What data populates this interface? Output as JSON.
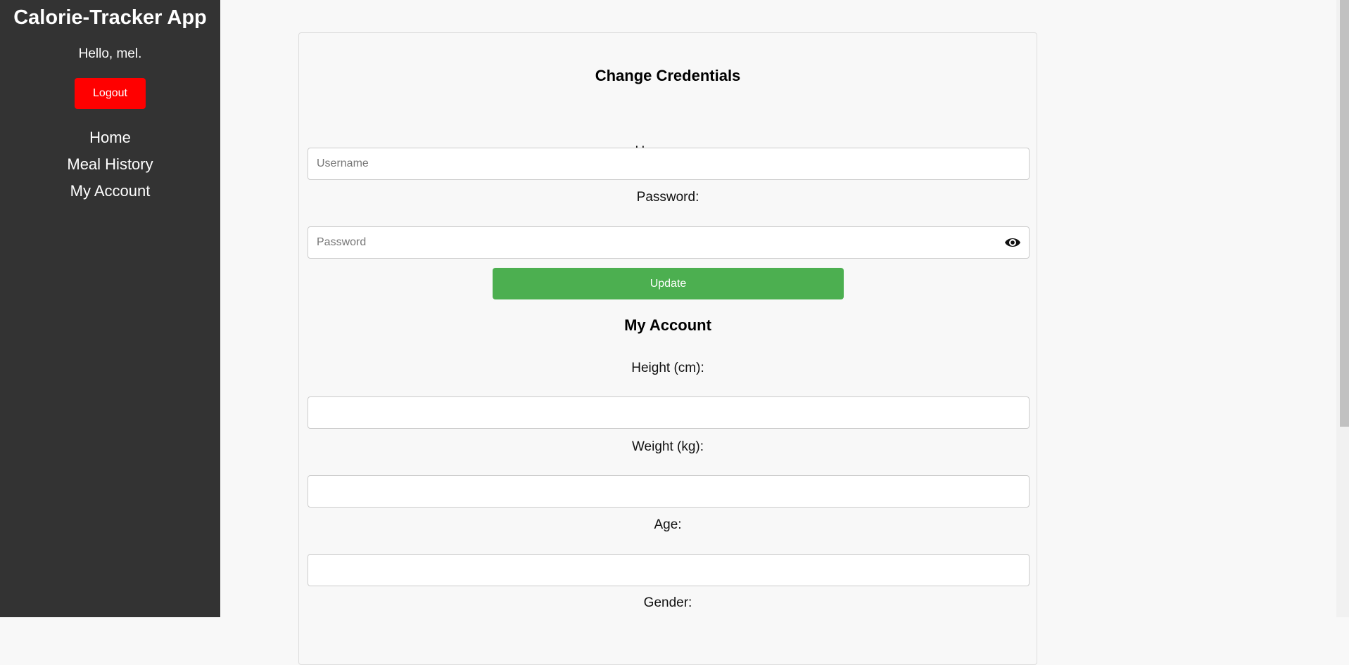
{
  "sidebar": {
    "title": "Calorie-Tracker App",
    "greeting": "Hello, mel.",
    "logout_label": "Logout",
    "nav": [
      {
        "label": "Home"
      },
      {
        "label": "Meal History"
      },
      {
        "label": "My Account"
      }
    ]
  },
  "credentials": {
    "title": "Change Credentials",
    "username_label": "Username:",
    "username_placeholder": "Username",
    "username_value": "",
    "password_label": "Password:",
    "password_placeholder": "Password",
    "password_value": "",
    "update_label": "Update"
  },
  "account": {
    "title": "My Account",
    "height_label": "Height (cm):",
    "height_value": "",
    "weight_label": "Weight (kg):",
    "weight_value": "",
    "age_label": "Age:",
    "age_value": "",
    "gender_label": "Gender:"
  },
  "colors": {
    "sidebar_bg": "#333333",
    "logout_bg": "#ff0000",
    "update_bg": "#4caf50",
    "page_bg": "#f8f8f8"
  },
  "icons": {
    "password_toggle": "eye-icon"
  }
}
